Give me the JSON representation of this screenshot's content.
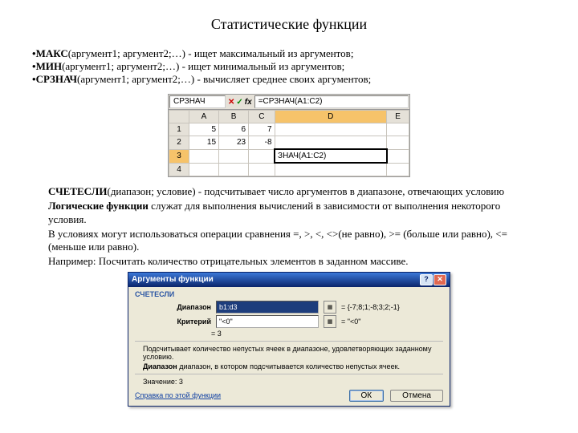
{
  "title": "Статистические функции",
  "bullets": [
    {
      "fn": "МАКС",
      "args": "(аргумент1; аргумент2;…)",
      "desc": " - ищет максимальный из аргументов;"
    },
    {
      "fn": "МИН",
      "args": "(аргумент1; аргумент2;…)",
      "desc": " - ищет минимальный из аргументов;"
    },
    {
      "fn": "СРЗНАЧ",
      "args": "(аргумент1; аргумент2;…)",
      "desc": " - вычисляет среднее своих аргументов;"
    }
  ],
  "excel": {
    "namebox": "СРЗНАЧ",
    "fx_x": "✕",
    "fx_v": "✓",
    "fx_fx": "fx",
    "formula": "=СРЗНАЧ(A1:C2)",
    "cols": [
      "A",
      "B",
      "C",
      "D",
      "E"
    ],
    "rows": [
      {
        "hdr": "1",
        "cells": [
          "5",
          "6",
          "7",
          "",
          ""
        ]
      },
      {
        "hdr": "2",
        "cells": [
          "15",
          "23",
          "-8",
          "",
          ""
        ]
      },
      {
        "hdr": "3",
        "cells": [
          "",
          "",
          "",
          "ЗНАЧ(A1:C2)",
          ""
        ],
        "active_col": 3
      },
      {
        "hdr": "4",
        "cells": [
          "",
          "",
          "",
          "",
          ""
        ]
      }
    ]
  },
  "body": {
    "p1a": "СЧЕТЕСЛИ",
    "p1b": "(диапазон; условие) - подсчитывает число аргументов в диапазоне, отвечающих условию",
    "p2a": "Логические функции",
    "p2b": " служат для выполнения вычислений в зависимости от выполнения некоторого условия.",
    "p3": "В условиях могут использоваться операции сравнения =, >, <, <>(не равно), >= (больше или равно), <= (меньше или равно).",
    "p4": "Например: Посчитать количество отрицательных элементов в заданном массиве."
  },
  "dialog": {
    "title": "Аргументы функции",
    "help_btn": "?",
    "close_btn": "✕",
    "func": "СЧЕТЕСЛИ",
    "arg1_label": "Диапазон",
    "arg1_value": "b1:d3",
    "arg1_eval": "= {-7;8;1;-8;3;2;-1}",
    "arg2_label": "Критерий",
    "arg2_value": "\"<0\"",
    "arg2_eval": "= \"<0\"",
    "result_eq": "= 3",
    "desc1": "Подсчитывает количество непустых ячеек в диапазоне, удовлетворяющих заданному условию.",
    "desc2_label": "Диапазон",
    "desc2_text": "   диапазон, в котором подсчитывается количество непустых ячеек.",
    "value_label": "Значение:  3",
    "help_link": "Справка по этой функции",
    "ok": "ОК",
    "cancel": "Отмена"
  }
}
